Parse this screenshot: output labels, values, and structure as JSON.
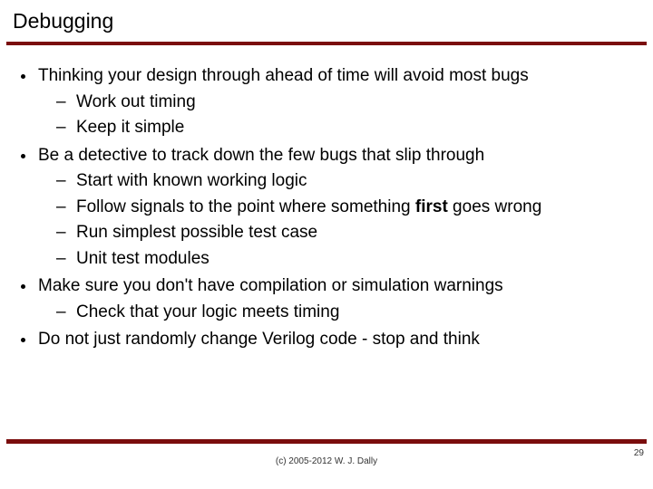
{
  "title": "Debugging",
  "b1": "Thinking your design through ahead of time will avoid most bugs",
  "b1s1": "Work out timing",
  "b1s2": "Keep it simple",
  "b2": "Be a detective to track down the few bugs that slip through",
  "b2s1": "Start with known working logic",
  "b2s2a": "Follow signals to the point where something ",
  "b2s2b": "first",
  "b2s2c": " goes wrong",
  "b2s3": "Run simplest possible test case",
  "b2s4": "Unit test modules",
  "b3": "Make sure you don't have compilation or simulation warnings",
  "b3s1": "Check that your logic meets timing",
  "b4": "Do not just randomly change Verilog code - stop and think",
  "footer": "(c) 2005-2012 W. J. Dally",
  "page": "29"
}
